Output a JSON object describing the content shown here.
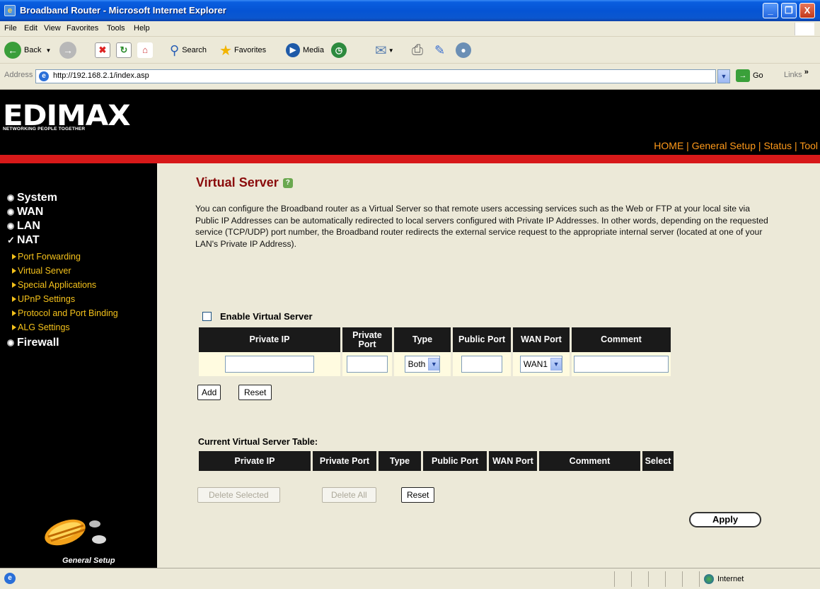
{
  "window": {
    "title": "Broadband Router - Microsoft Internet Explorer",
    "minimize": "_",
    "maximize": "❐",
    "close": "X"
  },
  "menu": [
    "File",
    "Edit",
    "View",
    "Favorites",
    "Tools",
    "Help"
  ],
  "toolbar": {
    "back": "Back",
    "search": "Search",
    "favorites": "Favorites",
    "media": "Media"
  },
  "address": {
    "label": "Address",
    "url": "http://192.168.2.1/index.asp",
    "go": "Go",
    "links": "Links",
    "links_chevron": "»"
  },
  "banner": {
    "logo": "EDIMAX",
    "tagline": "NETWORKING PEOPLE TOGETHER",
    "nav": [
      "HOME",
      "General Setup",
      "Status",
      "Tool"
    ],
    "nav_sep": " | "
  },
  "sidebar": {
    "main": {
      "system": "System",
      "wan": "WAN",
      "lan": "LAN",
      "nat": "NAT",
      "firewall": "Firewall"
    },
    "nat_sub": [
      "Port Forwarding",
      "Virtual Server",
      "Special Applications",
      "UPnP Settings",
      "Protocol and Port Binding",
      "ALG Settings"
    ],
    "footer": "General Setup"
  },
  "content": {
    "heading": "Virtual Server",
    "description": "You can configure the Broadband router as a Virtual Server so that remote users accessing services such as the Web or FTP at your local site via Public IP Addresses can be automatically redirected to local servers configured with Private IP Addresses. In other words, depending on the requested service (TCP/UDP) port number, the Broadband router redirects the external service request to the appropriate internal server (located at one of your LAN's Private IP Address).",
    "enable_label": "Enable Virtual Server",
    "enable_checked": false,
    "form_headers": [
      "Private IP",
      "Private Port",
      "Type",
      "Public Port",
      "WAN Port",
      "Comment"
    ],
    "form_values": {
      "type": "Both",
      "wan_port": "WAN1"
    },
    "add_button": "Add",
    "reset_button": "Reset",
    "current_table_label": "Current Virtual Server Table:",
    "current_headers": [
      "Private IP",
      "Private Port",
      "Type",
      "Public Port",
      "WAN Port",
      "Comment",
      "Select"
    ],
    "delete_selected": "Delete Selected",
    "delete_all": "Delete All",
    "reset2": "Reset",
    "apply": "Apply"
  },
  "statusbar": {
    "zone": "Internet"
  },
  "colors": {
    "heading": "#8a0b0b",
    "nav": "#ff9a1a",
    "submenu": "#f5c21b",
    "redbar": "#d71919"
  }
}
